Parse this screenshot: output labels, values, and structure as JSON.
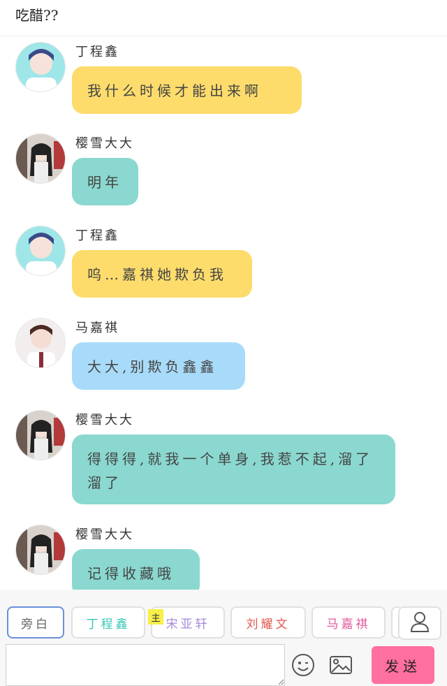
{
  "top_text": "吃醋??",
  "messages": [
    {
      "name": "丁程鑫",
      "text": "我什么时候才能出来啊",
      "avatar": "avatar-dingchengxin"
    },
    {
      "name": "樱雪大大",
      "text": "明年",
      "avatar": "avatar-yingxue"
    },
    {
      "name": "丁程鑫",
      "text": "呜…嘉祺她欺负我",
      "avatar": "avatar-dingchengxin"
    },
    {
      "name": "马嘉祺",
      "text": "大大,别欺负鑫鑫",
      "avatar": "avatar-majiaqi"
    },
    {
      "name": "樱雪大大",
      "text": "得得得,就我一个单身,我惹不起,溜了溜了",
      "avatar": "avatar-yingxue"
    },
    {
      "name": "樱雪大大",
      "text": "记得收藏哦",
      "avatar": "avatar-yingxue"
    }
  ],
  "footer": {
    "roles": [
      "旁白",
      "丁程鑫",
      "宋亚轩",
      "刘耀文",
      "马嘉祺"
    ],
    "host_badge": "主",
    "send_label": "发送",
    "input_placeholder": ""
  },
  "colors": {
    "bubble_yellow": "#fddc6c",
    "bubble_teal": "#8ad8cf",
    "bubble_blue": "#a8dbf9",
    "send_button": "#ff6f9f",
    "role_dingchengxin": "#39c7b4",
    "role_songyaxuan": "#a78bd8",
    "role_liuyaowen": "#e2574c",
    "role_majiaqi": "#e2589c"
  },
  "icons": [
    "emoji-icon",
    "image-icon",
    "user-icon"
  ]
}
